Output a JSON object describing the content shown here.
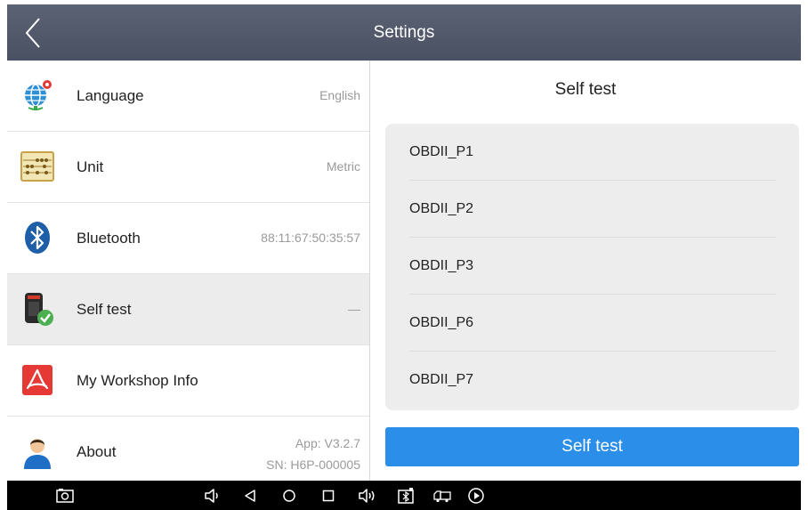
{
  "header": {
    "title": "Settings"
  },
  "settings": {
    "items": [
      {
        "label": "Language",
        "value": "English"
      },
      {
        "label": "Unit",
        "value": "Metric"
      },
      {
        "label": "Bluetooth",
        "value": "88:11:67:50:35:57"
      },
      {
        "label": "Self test",
        "value": "—"
      },
      {
        "label": "My Workshop Info",
        "value": ""
      },
      {
        "label": "About",
        "value": "App: V3.2.7",
        "value2": "SN: H6P-000005"
      }
    ]
  },
  "selftest": {
    "heading": "Self test",
    "items": [
      "OBDII_P1",
      "OBDII_P2",
      "OBDII_P3",
      "OBDII_P6",
      "OBDII_P7"
    ],
    "button_label": "Self test"
  },
  "colors": {
    "accent": "#2b8ee8",
    "topbar": "#525a6b",
    "selected_row": "#ececec"
  },
  "navbar_icons": [
    "screenshot-icon",
    "volume-down-icon",
    "back-icon",
    "home-icon",
    "recents-icon",
    "volume-up-icon",
    "vci-icon",
    "truck-icon",
    "play-icon"
  ]
}
